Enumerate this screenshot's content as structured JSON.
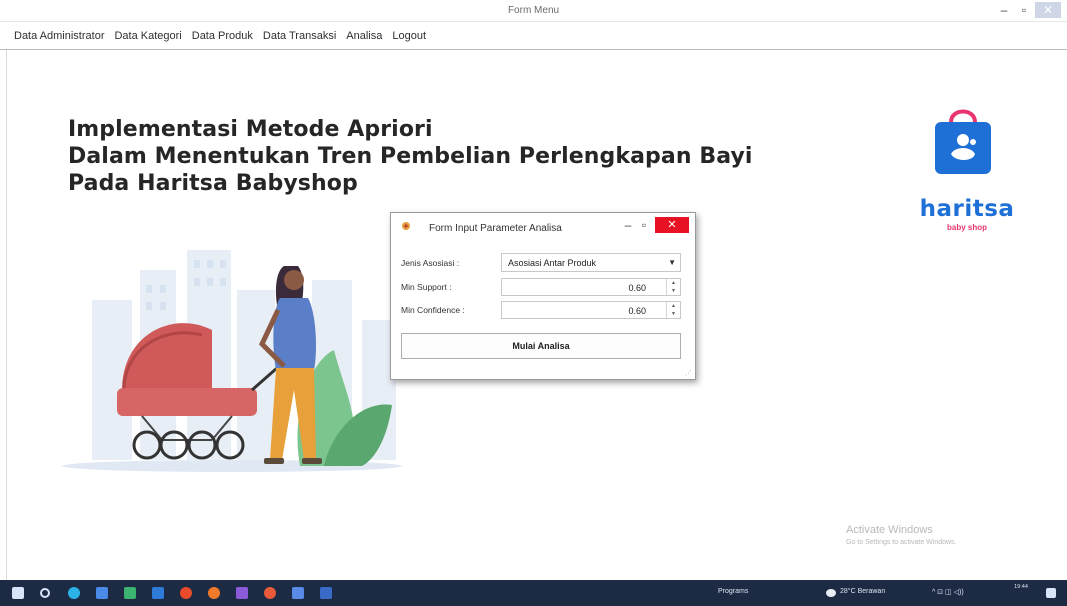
{
  "window": {
    "title": "Form Menu"
  },
  "menu": {
    "items": [
      "Data Administrator",
      "Data Kategori",
      "Data Produk",
      "Data Transaksi",
      "Analisa",
      "Logout"
    ]
  },
  "heading": {
    "line1": "Implementasi Metode Apriori",
    "line2": "Dalam Menentukan Tren Pembelian Perlengkapan Bayi",
    "line3": "Pada Haritsa Babyshop"
  },
  "logo": {
    "brand": "haritsa",
    "sub": "baby shop",
    "colors": {
      "blue": "#1e6fd6",
      "pink": "#e8356d"
    }
  },
  "dialog": {
    "title": "Form Input Parameter Analisa",
    "jenis_label": "Jenis Asosiasi :",
    "jenis_value": "Asosiasi Antar Produk",
    "support_label": "Min Support :",
    "support_value": "0.60",
    "confidence_label": "Min Confidence :",
    "confidence_value": "0.60",
    "button": "Mulai Analisa"
  },
  "watermark": {
    "line1": "Activate Windows",
    "line2": "Go to Settings to activate Windows."
  },
  "taskbar": {
    "programs": "Programs",
    "weather": "28°C Berawan",
    "time": "19:44"
  }
}
